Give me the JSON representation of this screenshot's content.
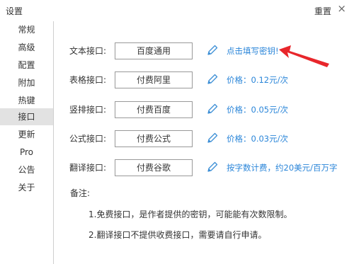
{
  "window": {
    "title": "设置",
    "reset_label": "重置",
    "close_symbol": "×"
  },
  "sidebar": {
    "items": [
      {
        "label": "常规"
      },
      {
        "label": "高级"
      },
      {
        "label": "配置"
      },
      {
        "label": "附加"
      },
      {
        "label": "热键"
      },
      {
        "label": "接口",
        "active": true
      },
      {
        "label": "更新"
      },
      {
        "label": "Pro"
      },
      {
        "label": "公告"
      },
      {
        "label": "关于"
      }
    ]
  },
  "interfaces": [
    {
      "label": "文本接口:",
      "value": "百度通用",
      "info": "点击填写密钥!"
    },
    {
      "label": "表格接口:",
      "value": "付费阿里",
      "info": "价格：0.12元/次"
    },
    {
      "label": "竖排接口:",
      "value": "付费百度",
      "info": "价格：0.05元/次"
    },
    {
      "label": "公式接口:",
      "value": "付费公式",
      "info": "价格：0.03元/次"
    },
    {
      "label": "翻译接口:",
      "value": "付费谷歌",
      "info": "按字数计费，约20美元/百万字"
    }
  ],
  "notes": {
    "title": "备注:",
    "items": [
      "1.免费接口，是作者提供的密钥，可能能有次数限制。",
      "2.翻译接口不提供收费接口，需要请自行申请。"
    ]
  },
  "colors": {
    "accent_blue": "#2b86d9",
    "annotation_red": "#e8262b",
    "active_sidebar": "#e2e2e2"
  },
  "icons": {
    "edit": "pencil-icon"
  }
}
